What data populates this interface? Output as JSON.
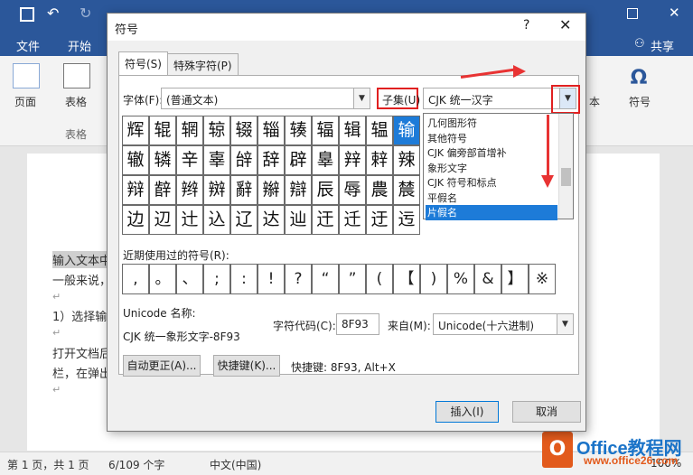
{
  "word": {
    "ribbon_tabs": [
      "文件",
      "开始"
    ],
    "share_label": "共享",
    "groups": {
      "pages_label": "页面",
      "table_label": "表格",
      "table_group_label": "表格",
      "symbol_label": "符号",
      "text_label": "本"
    },
    "document_lines": [
      "输入文本中",
      "一般来说，",
      "1）选择输",
      "打开文档后",
      "栏，在弹出"
    ],
    "status": {
      "page": "第 1 页，共 1 页",
      "words": "6/109 个字",
      "language": "中文(中国)",
      "zoom": "100%"
    }
  },
  "logo": {
    "icon_letter": "O",
    "brand": "Office教程网",
    "url": "www.office26.com"
  },
  "dialog": {
    "title": "符号",
    "help": "?",
    "close": "✕",
    "tabs": [
      "符号(S)",
      "特殊字符(P)"
    ],
    "font_label": "字体(F):",
    "font_value": "(普通文本)",
    "subset_label": "子集(U)",
    "subset_value": "CJK 统一汉字",
    "subset_options": [
      "几何图形符",
      "其他符号",
      "CJK 偏旁部首增补",
      "象形文字",
      "CJK 符号和标点",
      "平假名",
      "片假名"
    ],
    "subset_highlight_index": 6,
    "grid": [
      [
        "辉",
        "辊",
        "辋",
        "辌",
        "辍",
        "辎",
        "辏",
        "辐",
        "辑",
        "辒",
        "输"
      ],
      [
        "辙",
        "辚",
        "辛",
        "辜",
        "辝",
        "辞",
        "辟",
        "辠",
        "辡",
        "辢",
        "辣"
      ],
      [
        "辩",
        "辪",
        "辫",
        "辬",
        "辭",
        "辮",
        "辯",
        "辰",
        "辱",
        "農",
        "辳"
      ],
      [
        "边",
        "辺",
        "辻",
        "込",
        "辽",
        "达",
        "辿",
        "迀",
        "迁",
        "迂",
        "迃"
      ]
    ],
    "selected_cell": [
      0,
      10
    ],
    "recent_label": "近期使用过的符号(R):",
    "recent": [
      ",",
      "。",
      "、",
      ";",
      ":",
      "!",
      "?",
      "“",
      "”",
      "(",
      "【",
      ")",
      "%",
      "&",
      "】",
      "※"
    ],
    "unicode_name_label": "Unicode 名称:",
    "unicode_name_value": "CJK 统一象形文字-8F93",
    "char_code_label": "字符代码(C):",
    "char_code_value": "8F93",
    "from_label": "来自(M):",
    "from_value": "Unicode(十六进制)",
    "autocorrect_button": "自动更正(A)...",
    "shortcut_button": "快捷键(K)...",
    "shortcut_text": "快捷键: 8F93, Alt+X",
    "insert_button": "插入(I)",
    "cancel_button": "取消"
  }
}
